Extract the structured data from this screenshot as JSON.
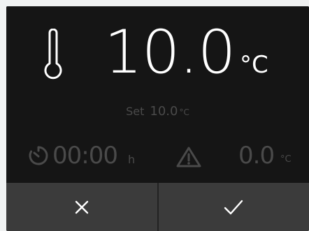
{
  "display": {
    "current_temp": "10.0",
    "temp_unit": "°C",
    "setpoint": {
      "label": "Set",
      "value": "10.0",
      "unit": "°C"
    },
    "timer": {
      "value": "00:00",
      "unit": "h"
    },
    "alarm": {
      "value": "0.0",
      "unit": "°C"
    }
  },
  "buttons": {
    "cancel": "X"
  },
  "icons": {
    "temperature": "thermometer-icon",
    "timer": "timer-icon",
    "warning": "warning-icon",
    "confirm": "checkmark-icon"
  },
  "colors": {
    "panel_background": "#151515",
    "button_background": "#3b3b3b",
    "primary_text": "#ffffff",
    "dim_text": "#4a4a4a"
  }
}
